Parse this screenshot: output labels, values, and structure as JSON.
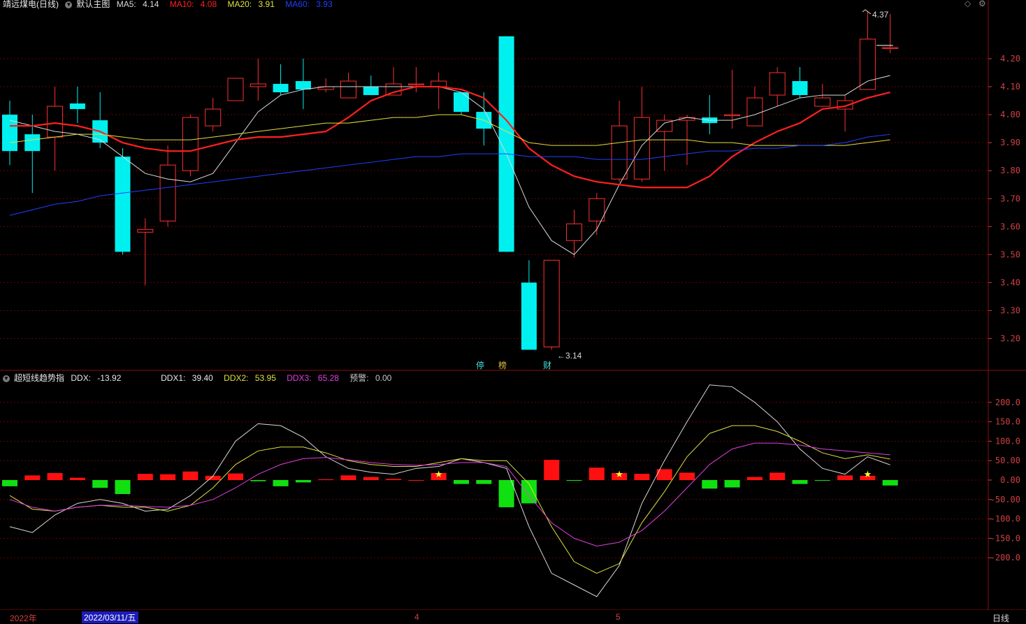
{
  "header_top": {
    "stock_name": "靖远煤电(日线)",
    "template": "默认主图",
    "ma5": {
      "label": "MA5:",
      "value": "4.14",
      "color": "#d8d8d8"
    },
    "ma10": {
      "label": "MA10:",
      "value": "4.08",
      "color": "#ff2020"
    },
    "ma20": {
      "label": "MA20:",
      "value": "3.91",
      "color": "#e0e040"
    },
    "ma60": {
      "label": "MA60:",
      "value": "3.93",
      "color": "#2040ff"
    }
  },
  "header_sub": {
    "indicator_name": "超短线趋势指",
    "ddx": {
      "label": "DDX:",
      "value": "-13.92"
    },
    "ddx1": {
      "label": "DDX1:",
      "value": "39.40",
      "color": "#d8d8d8"
    },
    "ddx2": {
      "label": "DDX2:",
      "value": "53.95",
      "color": "#e0e040"
    },
    "ddx3": {
      "label": "DDX3:",
      "value": "65.28",
      "color": "#e040e0"
    },
    "alert": {
      "label": "预警:",
      "value": "0.00",
      "color": "#c8c8c8"
    }
  },
  "x_axis": {
    "year_label": "2022年",
    "cursor_date": "2022/03/11/五",
    "month4": "4",
    "month5": "5",
    "period": "日线"
  },
  "colors": {
    "up": "#ff3030",
    "down": "#00f0f0",
    "bar_pos": "#ff1010",
    "bar_neg": "#10e010",
    "grid": "#6a0000",
    "axis": "#8a1010",
    "tick": "#d04040"
  },
  "chart_data": [
    {
      "type": "candlestick",
      "title": "靖远煤电(日线)",
      "ylim": [
        3.1,
        4.45
      ],
      "y_ticks": [
        "4.20",
        "4.10",
        "4.00",
        "3.90",
        "3.80",
        "3.70",
        "3.60",
        "3.50",
        "3.40",
        "3.30",
        "3.20"
      ],
      "candles": [
        [
          4.0,
          4.05,
          3.82,
          3.87
        ],
        [
          3.93,
          4.0,
          3.72,
          3.87
        ],
        [
          3.92,
          4.1,
          3.8,
          4.03
        ],
        [
          4.04,
          4.1,
          3.97,
          4.02
        ],
        [
          3.98,
          4.08,
          3.88,
          3.9
        ],
        [
          3.85,
          3.88,
          3.5,
          3.51
        ],
        [
          3.58,
          3.63,
          3.39,
          3.59
        ],
        [
          3.62,
          3.89,
          3.6,
          3.82
        ],
        [
          3.8,
          4.0,
          3.78,
          3.99
        ],
        [
          3.96,
          4.06,
          3.94,
          4.02
        ],
        [
          4.05,
          4.13,
          4.05,
          4.13
        ],
        [
          4.1,
          4.2,
          4.05,
          4.11
        ],
        [
          4.11,
          4.18,
          4.07,
          4.08
        ],
        [
          4.12,
          4.2,
          4.02,
          4.09
        ],
        [
          4.09,
          4.13,
          4.08,
          4.1
        ],
        [
          4.06,
          4.15,
          4.06,
          4.12
        ],
        [
          4.1,
          4.14,
          4.08,
          4.07
        ],
        [
          4.07,
          4.17,
          4.07,
          4.11
        ],
        [
          4.11,
          4.17,
          4.08,
          4.11
        ],
        [
          4.1,
          4.15,
          4.02,
          4.12
        ],
        [
          4.08,
          4.08,
          4.0,
          4.01
        ],
        [
          4.01,
          4.08,
          3.89,
          3.95
        ],
        [
          4.28,
          4.28,
          3.51,
          3.51
        ],
        [
          3.4,
          3.48,
          3.16,
          3.16
        ],
        [
          3.17,
          3.48,
          3.16,
          3.48
        ],
        [
          3.55,
          3.66,
          3.49,
          3.61
        ],
        [
          3.62,
          3.72,
          3.57,
          3.7
        ],
        [
          3.77,
          4.05,
          3.76,
          3.96
        ],
        [
          3.77,
          4.1,
          3.76,
          3.99
        ],
        [
          3.94,
          4.0,
          3.8,
          3.98
        ],
        [
          3.98,
          4.0,
          3.82,
          3.99
        ],
        [
          3.99,
          4.07,
          3.93,
          3.97
        ],
        [
          4.0,
          4.16,
          3.95,
          4.0
        ],
        [
          3.96,
          4.1,
          3.96,
          4.06
        ],
        [
          4.07,
          4.17,
          4.03,
          4.15
        ],
        [
          4.12,
          4.17,
          4.06,
          4.07
        ],
        [
          4.03,
          4.11,
          4.03,
          4.06
        ],
        [
          4.02,
          4.07,
          3.94,
          4.05
        ],
        [
          4.09,
          4.37,
          4.09,
          4.27
        ],
        [
          4.24,
          4.36,
          4.22,
          4.24
        ]
      ],
      "series": [
        {
          "name": "MA5",
          "values": [
            3.98,
            3.96,
            3.94,
            3.93,
            3.91,
            3.85,
            3.79,
            3.77,
            3.76,
            3.79,
            3.9,
            4.01,
            4.07,
            4.09,
            4.1,
            4.1,
            4.1,
            4.1,
            4.1,
            4.1,
            4.08,
            4.02,
            3.86,
            3.67,
            3.55,
            3.5,
            3.59,
            3.75,
            3.89,
            3.97,
            3.99,
            3.98,
            3.98,
            4.0,
            4.03,
            4.06,
            4.07,
            4.07,
            4.12,
            4.14
          ]
        },
        {
          "name": "MA10",
          "values": [
            3.96,
            3.96,
            3.97,
            3.96,
            3.94,
            3.9,
            3.88,
            3.87,
            3.87,
            3.89,
            3.91,
            3.92,
            3.92,
            3.93,
            3.94,
            3.99,
            4.05,
            4.08,
            4.1,
            4.1,
            4.09,
            4.06,
            3.98,
            3.88,
            3.82,
            3.78,
            3.76,
            3.75,
            3.74,
            3.74,
            3.74,
            3.78,
            3.85,
            3.9,
            3.94,
            3.97,
            4.02,
            4.03,
            4.06,
            4.08
          ]
        },
        {
          "name": "MA20",
          "values": [
            3.9,
            3.91,
            3.92,
            3.93,
            3.93,
            3.92,
            3.91,
            3.91,
            3.91,
            3.92,
            3.93,
            3.94,
            3.95,
            3.96,
            3.97,
            3.97,
            3.98,
            3.99,
            3.99,
            4.0,
            4.0,
            3.98,
            3.94,
            3.9,
            3.89,
            3.89,
            3.89,
            3.9,
            3.91,
            3.91,
            3.91,
            3.9,
            3.9,
            3.89,
            3.89,
            3.89,
            3.89,
            3.89,
            3.9,
            3.91
          ]
        },
        {
          "name": "MA60",
          "values": [
            3.64,
            3.66,
            3.68,
            3.69,
            3.71,
            3.72,
            3.73,
            3.74,
            3.75,
            3.76,
            3.77,
            3.78,
            3.79,
            3.8,
            3.81,
            3.82,
            3.83,
            3.84,
            3.85,
            3.85,
            3.86,
            3.86,
            3.86,
            3.85,
            3.85,
            3.85,
            3.84,
            3.84,
            3.84,
            3.85,
            3.86,
            3.87,
            3.87,
            3.88,
            3.88,
            3.89,
            3.89,
            3.9,
            3.92,
            3.93
          ]
        }
      ],
      "annotations": {
        "high_label": "4.37",
        "low_label": "3.14",
        "marker_1": "停",
        "marker_2": "榜",
        "marker_3": "财"
      }
    },
    {
      "type": "bar",
      "title": "超短线趋势指",
      "ylim": [
        -325,
        245
      ],
      "y_ticks": [
        "200.0",
        "150.0",
        "100.0",
        "50.00",
        "0.00",
        "-50.00",
        "-100.0",
        "-150.0",
        "-200.0"
      ],
      "values": [
        -16,
        12,
        18,
        6,
        -20,
        -36,
        16,
        15,
        22,
        11,
        17,
        -3,
        -16,
        -6,
        2,
        12,
        8,
        3,
        0,
        18,
        -10,
        -10,
        -70,
        -60,
        52,
        -2,
        32,
        18,
        16,
        28,
        19,
        -22,
        -19,
        8,
        19,
        -10,
        -1,
        12,
        11,
        -14
      ],
      "star_indices": [
        19,
        27,
        38
      ],
      "series": [
        {
          "name": "DDX1",
          "values": [
            -120,
            -135,
            -90,
            -60,
            -50,
            -60,
            -80,
            -75,
            -40,
            10,
            100,
            145,
            140,
            110,
            60,
            30,
            20,
            15,
            30,
            35,
            55,
            45,
            30,
            -120,
            -240,
            -270,
            -300,
            -220,
            -60,
            50,
            150,
            245,
            240,
            200,
            150,
            80,
            30,
            15,
            60,
            39
          ]
        },
        {
          "name": "DDX2",
          "values": [
            -40,
            -75,
            -80,
            -70,
            -65,
            -70,
            -70,
            -80,
            -65,
            -20,
            40,
            75,
            85,
            85,
            70,
            50,
            40,
            35,
            35,
            45,
            55,
            50,
            50,
            -10,
            -120,
            -210,
            -240,
            -215,
            -110,
            -30,
            60,
            120,
            140,
            140,
            125,
            100,
            70,
            55,
            65,
            54
          ]
        },
        {
          "name": "DDX3",
          "values": [
            -50,
            -70,
            -80,
            -70,
            -65,
            -65,
            -68,
            -70,
            -65,
            -50,
            -20,
            15,
            40,
            55,
            58,
            52,
            45,
            40,
            38,
            40,
            45,
            45,
            35,
            -40,
            -110,
            -150,
            -170,
            -160,
            -130,
            -80,
            -20,
            40,
            80,
            95,
            95,
            90,
            80,
            75,
            70,
            65
          ]
        }
      ]
    }
  ]
}
